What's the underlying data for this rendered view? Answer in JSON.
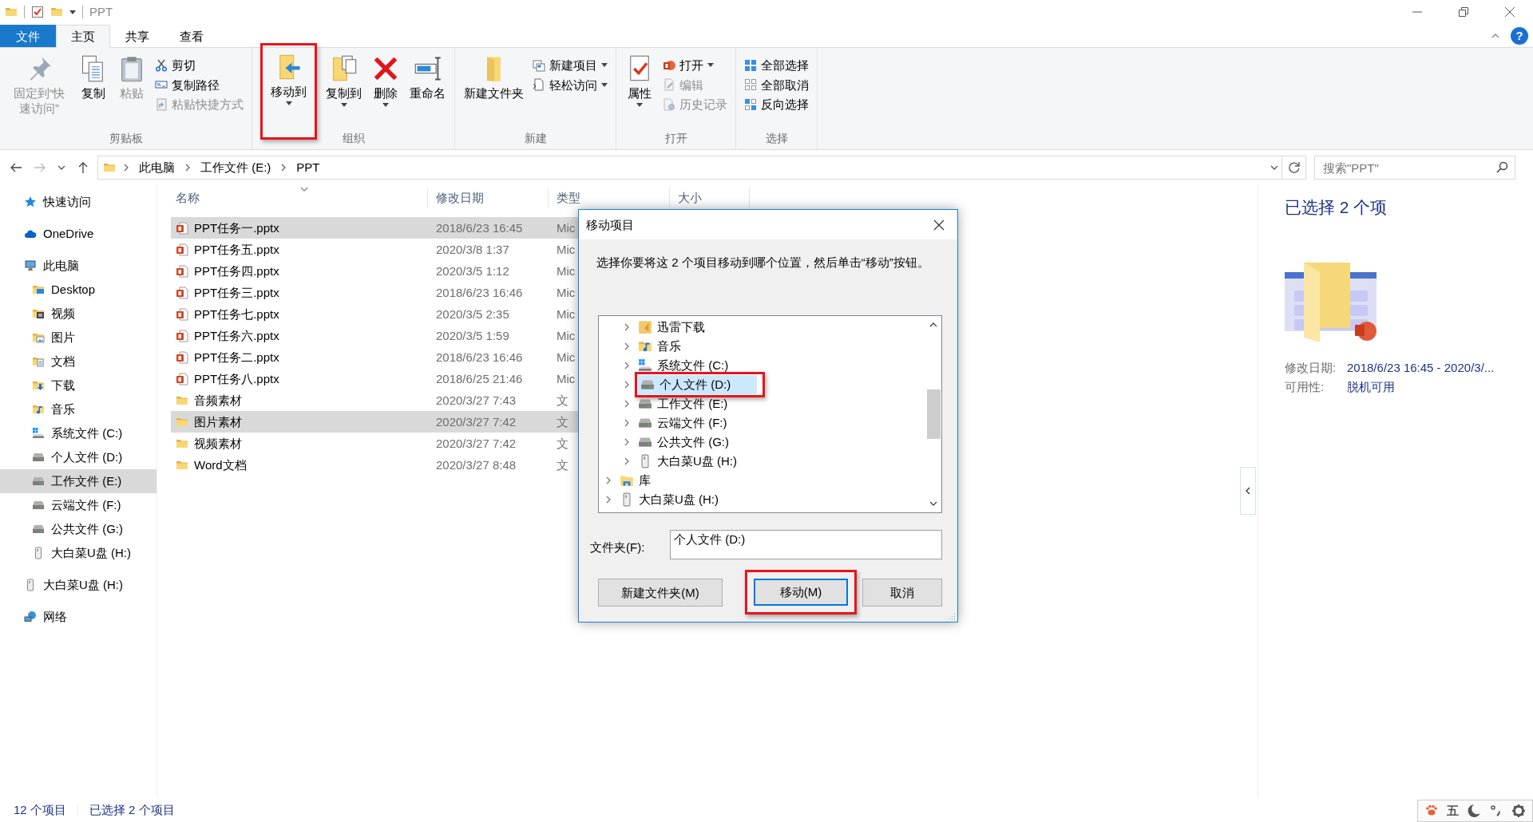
{
  "window": {
    "title": "PPT",
    "help": "?"
  },
  "ribbon_tabs": [
    {
      "label": "文件",
      "kind": "file",
      "selected": false
    },
    {
      "label": "主页",
      "kind": "tab",
      "selected": true
    },
    {
      "label": "共享",
      "kind": "tab",
      "selected": false
    },
    {
      "label": "查看",
      "kind": "tab",
      "selected": false
    }
  ],
  "ribbon_groups": [
    {
      "label": "剪贴板",
      "items": [
        {
          "label": "固定到“快速访问”",
          "kind": "large",
          "disabled": true,
          "dropdown": false,
          "highlighted": false
        },
        {
          "label": "复制",
          "kind": "large",
          "disabled": false,
          "dropdown": false,
          "highlighted": false
        },
        {
          "label": "粘贴",
          "kind": "large",
          "disabled": true,
          "dropdown": false,
          "highlighted": false
        },
        {
          "label": "剪切",
          "kind": "small",
          "disabled": false,
          "dropdown": false,
          "highlighted": false
        },
        {
          "label": "复制路径",
          "kind": "small",
          "disabled": false,
          "dropdown": false,
          "highlighted": false
        },
        {
          "label": "粘贴快捷方式",
          "kind": "small",
          "disabled": true,
          "dropdown": false,
          "highlighted": false
        }
      ]
    },
    {
      "label": "组织",
      "items": [
        {
          "label": "移动到",
          "kind": "large",
          "disabled": false,
          "dropdown": true,
          "highlighted": true
        },
        {
          "label": "复制到",
          "kind": "large",
          "disabled": false,
          "dropdown": true,
          "highlighted": false
        },
        {
          "label": "删除",
          "kind": "large",
          "disabled": false,
          "dropdown": true,
          "highlighted": false
        },
        {
          "label": "重命名",
          "kind": "large",
          "disabled": false,
          "dropdown": false,
          "highlighted": false
        }
      ]
    },
    {
      "label": "新建",
      "items": [
        {
          "label": "新建文件夹",
          "kind": "large",
          "disabled": false,
          "dropdown": false,
          "highlighted": false
        },
        {
          "label": "新建项目",
          "kind": "small",
          "disabled": false,
          "dropdown": true,
          "highlighted": false
        },
        {
          "label": "轻松访问",
          "kind": "small",
          "disabled": false,
          "dropdown": true,
          "highlighted": false
        }
      ]
    },
    {
      "label": "打开",
      "items": [
        {
          "label": "属性",
          "kind": "large",
          "disabled": false,
          "dropdown": true,
          "highlighted": false
        },
        {
          "label": "打开",
          "kind": "small",
          "disabled": false,
          "dropdown": true,
          "highlighted": false
        },
        {
          "label": "编辑",
          "kind": "small",
          "disabled": true,
          "dropdown": false,
          "highlighted": false
        },
        {
          "label": "历史记录",
          "kind": "small",
          "disabled": true,
          "dropdown": false,
          "highlighted": false
        }
      ]
    },
    {
      "label": "选择",
      "items": [
        {
          "label": "全部选择",
          "kind": "small",
          "disabled": false,
          "dropdown": false,
          "highlighted": false
        },
        {
          "label": "全部取消",
          "kind": "small",
          "disabled": false,
          "dropdown": false,
          "highlighted": false
        },
        {
          "label": "反向选择",
          "kind": "small",
          "disabled": false,
          "dropdown": false,
          "highlighted": false
        }
      ]
    }
  ],
  "address": {
    "back_disabled": false,
    "forward_disabled": true,
    "crumbs": [
      "此电脑",
      "工作文件 (E:)",
      "PPT"
    ],
    "search_placeholder": "搜索\"PPT\""
  },
  "sidebar": {
    "items": [
      {
        "label": "快速访问",
        "kind": "star",
        "selected": false
      },
      {
        "label": "OneDrive",
        "kind": "cloud",
        "selected": false
      },
      {
        "label": "此电脑",
        "kind": "computer",
        "selected": false,
        "children": [
          {
            "label": "Desktop",
            "kind": "desktop",
            "selected": false
          },
          {
            "label": "视频",
            "kind": "video",
            "selected": false
          },
          {
            "label": "图片",
            "kind": "pictures",
            "selected": false
          },
          {
            "label": "文档",
            "kind": "documents",
            "selected": false
          },
          {
            "label": "下载",
            "kind": "downloads",
            "selected": false
          },
          {
            "label": "音乐",
            "kind": "music",
            "selected": false
          },
          {
            "label": "系统文件 (C:)",
            "kind": "system-drive",
            "selected": false
          },
          {
            "label": "个人文件 (D:)",
            "kind": "drive",
            "selected": false
          },
          {
            "label": "工作文件 (E:)",
            "kind": "drive",
            "selected": true
          },
          {
            "label": "云端文件 (F:)",
            "kind": "drive",
            "selected": false
          },
          {
            "label": "公共文件 (G:)",
            "kind": "drive",
            "selected": false
          },
          {
            "label": "大白菜U盘 (H:)",
            "kind": "usb",
            "selected": false
          }
        ]
      },
      {
        "label": "大白菜U盘 (H:)",
        "kind": "usb",
        "selected": false
      },
      {
        "label": "网络",
        "kind": "network",
        "selected": false
      }
    ]
  },
  "table": {
    "columns": [
      "名称",
      "修改日期",
      "类型",
      "大小"
    ],
    "rows": [
      {
        "name": "PPT任务一.pptx",
        "date": "2018/6/23 16:45",
        "type": "Mic",
        "kind": "slides",
        "selected": true
      },
      {
        "name": "PPT任务五.pptx",
        "date": "2020/3/8 1:37",
        "type": "Mic",
        "kind": "slides",
        "selected": false
      },
      {
        "name": "PPT任务四.pptx",
        "date": "2020/3/5 1:12",
        "type": "Mic",
        "kind": "slides",
        "selected": false
      },
      {
        "name": "PPT任务三.pptx",
        "date": "2018/6/23 16:46",
        "type": "Mic",
        "kind": "slides",
        "selected": false
      },
      {
        "name": "PPT任务七.pptx",
        "date": "2020/3/5 2:35",
        "type": "Mic",
        "kind": "slides",
        "selected": false
      },
      {
        "name": "PPT任务六.pptx",
        "date": "2020/3/5 1:59",
        "type": "Mic",
        "kind": "slides",
        "selected": false
      },
      {
        "name": "PPT任务二.pptx",
        "date": "2018/6/23 16:46",
        "type": "Mic",
        "kind": "slides",
        "selected": false
      },
      {
        "name": "PPT任务八.pptx",
        "date": "2018/6/25 21:46",
        "type": "Mic",
        "kind": "slides",
        "selected": false
      },
      {
        "name": "音频素材",
        "date": "2020/3/27 7:43",
        "type": "文",
        "kind": "folder",
        "selected": false
      },
      {
        "name": "图片素材",
        "date": "2020/3/27 7:42",
        "type": "文",
        "kind": "folder",
        "selected": true
      },
      {
        "name": "视频素材",
        "date": "2020/3/27 7:42",
        "type": "文",
        "kind": "folder",
        "selected": false
      },
      {
        "name": "Word文档",
        "date": "2020/3/27 8:48",
        "type": "文",
        "kind": "folder",
        "selected": false
      }
    ]
  },
  "preview": {
    "heading": "已选择 2 个项",
    "properties": [
      {
        "label": "修改日期:",
        "value": "2018/6/23 16:45 - 2020/3/..."
      },
      {
        "label": "可用性:",
        "value": "脱机可用"
      }
    ]
  },
  "status_bar": [
    "12 个项目",
    "已选择 2 个项目"
  ],
  "dialog": {
    "title": "移动项目",
    "instruction": "选择你要将这 2 个项目移动到哪个位置，然后单击“移动”按钮。",
    "tree": {
      "nested_items": [
        {
          "label": "迅雷下载",
          "kind": "thunder",
          "selected": false,
          "highlighted": false
        },
        {
          "label": "音乐",
          "kind": "music",
          "selected": false,
          "highlighted": false
        },
        {
          "label": "系统文件 (C:)",
          "kind": "system-drive",
          "selected": false,
          "highlighted": false
        },
        {
          "label": "个人文件 (D:)",
          "kind": "drive",
          "selected": true,
          "highlighted": true
        },
        {
          "label": "工作文件 (E:)",
          "kind": "drive",
          "selected": false,
          "highlighted": false
        },
        {
          "label": "云端文件 (F:)",
          "kind": "drive",
          "selected": false,
          "highlighted": false
        },
        {
          "label": "公共文件 (G:)",
          "kind": "drive",
          "selected": false,
          "highlighted": false
        },
        {
          "label": "大白菜U盘 (H:)",
          "kind": "usb",
          "selected": false,
          "highlighted": false
        }
      ],
      "items": [
        {
          "label": "库",
          "kind": "library",
          "selected": false,
          "highlighted": false
        },
        {
          "label": "大白菜U盘 (H:)",
          "kind": "usb",
          "selected": false,
          "highlighted": false
        }
      ]
    },
    "folder_label": "文件夹(F):",
    "folder_value": "个人文件 (D:)",
    "buttons": [
      {
        "label": "新建文件夹(M)",
        "default": false,
        "highlighted": false
      },
      {
        "label": "移动(M)",
        "default": true,
        "highlighted": true
      },
      {
        "label": "取消",
        "default": false,
        "highlighted": false
      }
    ]
  },
  "ime_toolbar": [
    {
      "kind": "paw"
    },
    {
      "kind": "text",
      "label": "五"
    },
    {
      "kind": "moon"
    },
    {
      "kind": "punctuation"
    },
    {
      "kind": "gear"
    }
  ]
}
